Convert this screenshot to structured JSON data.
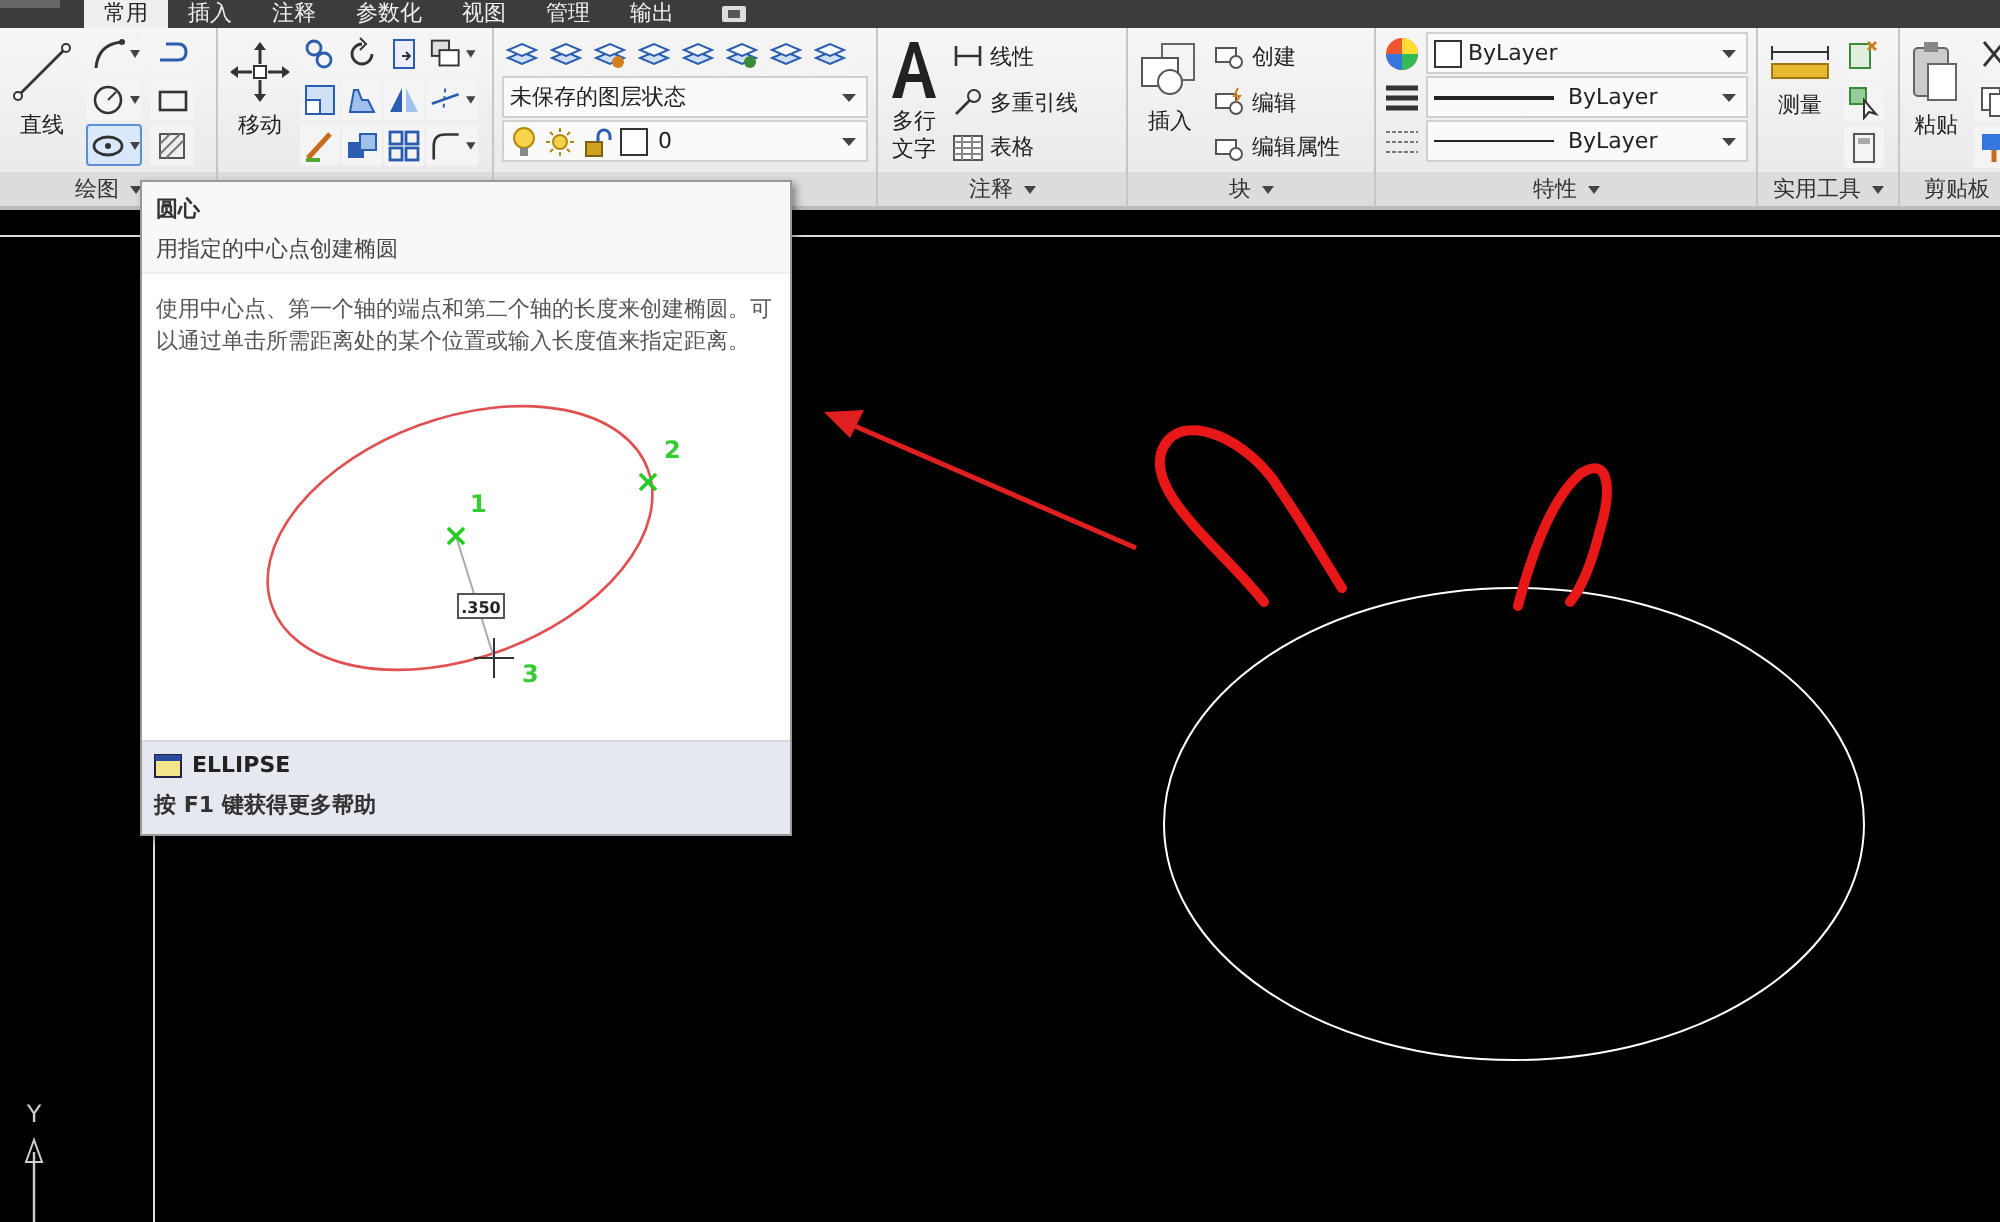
{
  "tabs": [
    {
      "label": "常用",
      "selected": true
    },
    {
      "label": "插入",
      "selected": false
    },
    {
      "label": "注释",
      "selected": false
    },
    {
      "label": "参数化",
      "selected": false
    },
    {
      "label": "视图",
      "selected": false
    },
    {
      "label": "管理",
      "selected": false
    },
    {
      "label": "输出",
      "selected": false
    }
  ],
  "ribbon": {
    "draw": {
      "title": "绘图",
      "big_button": "直线",
      "tools": [
        {
          "selected": false
        },
        {
          "selected": false
        },
        {
          "selected": false
        },
        {
          "selected": false
        },
        {
          "selected": true
        },
        {
          "selected": false
        }
      ]
    },
    "modify": {
      "big_button": "移动"
    },
    "layers": {
      "layer_state": "未保存的图层状态",
      "current_layer": "0"
    },
    "annotation": {
      "title": "注释",
      "big_button": [
        "多行",
        "文字"
      ],
      "items": [
        "线性",
        "多重引线",
        "表格"
      ]
    },
    "block": {
      "title": "块",
      "big_button": "插入",
      "items": [
        "创建",
        "编辑",
        "编辑属性"
      ]
    },
    "properties": {
      "title": "特性",
      "color_setting": "ByLayer",
      "lineweight": "ByLayer",
      "linetype": "ByLayer"
    },
    "utilities": {
      "title": "实用工具",
      "big_button": "测量"
    },
    "clipboard": {
      "title": "剪贴板",
      "big_button": "粘贴"
    }
  },
  "tooltip": {
    "title": "圆心",
    "subtitle": "用指定的中心点创建椭圆",
    "description": "使用中心点、第一个轴的端点和第二个轴的长度来创建椭圆。可以通过单击所需距离处的某个位置或输入长度值来指定距离。",
    "illustration_labels": [
      "1",
      "2",
      "3"
    ],
    "illustration_value": ".350",
    "command": "ELLIPSE",
    "help": "按 F1 键获得更多帮助"
  },
  "canvas": {
    "axis_label": "Y"
  }
}
